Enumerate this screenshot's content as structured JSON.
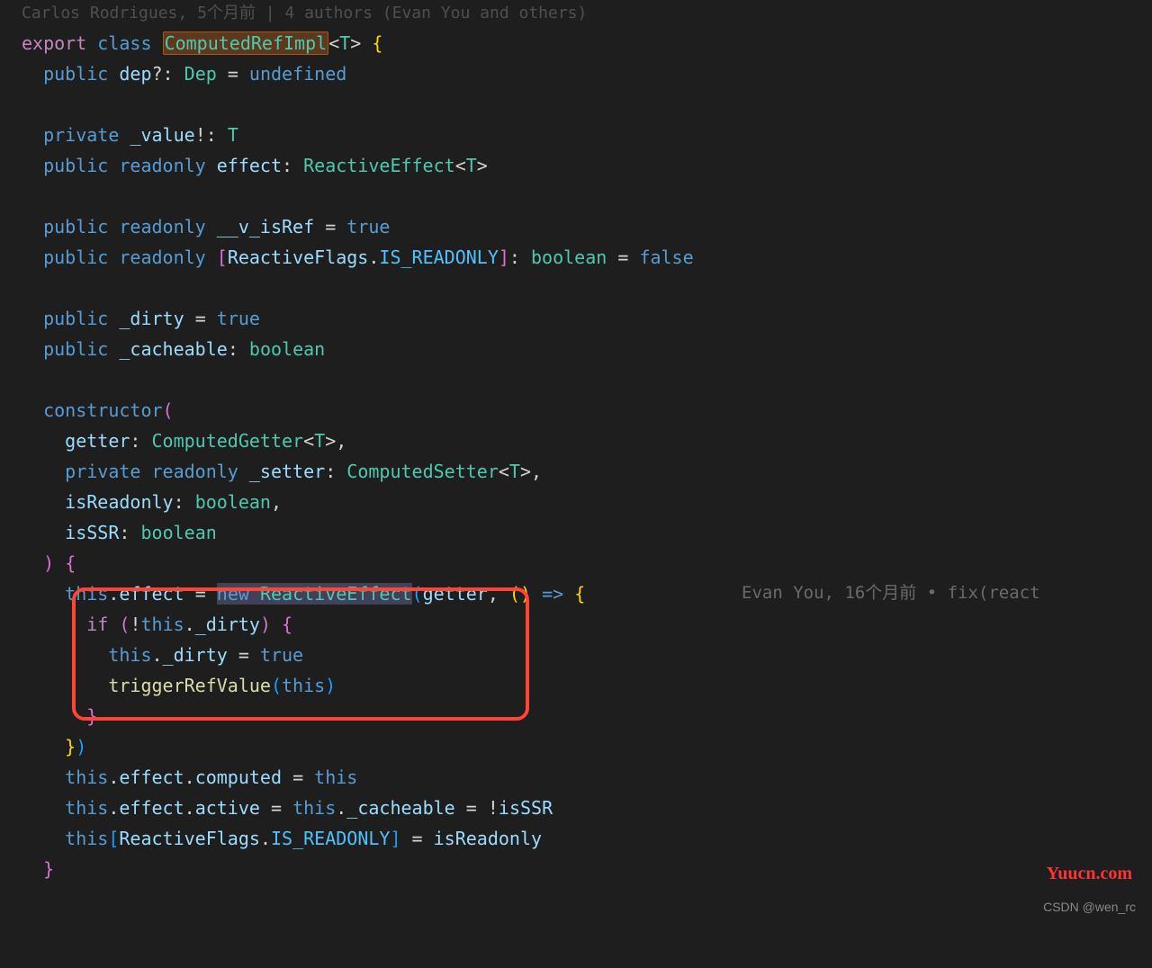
{
  "blame": {
    "top": "Carlos Rodrigues, 5个月前 | 4 authors (Evan You and others)",
    "inline": "Evan You, 16个月前 • fix(react"
  },
  "code": {
    "export": "export",
    "class": "class",
    "className": "ComputedRefImpl",
    "generic": "T",
    "public": "public",
    "private": "private",
    "readonly": "readonly",
    "constructor": "constructor",
    "this": "this",
    "new": "new",
    "if": "if",
    "undefined": "undefined",
    "true": "true",
    "false": "false",
    "boolean": "boolean",
    "dep": "dep",
    "depType": "Dep",
    "_value": "_value",
    "effect": "effect",
    "reactiveEffect": "ReactiveEffect",
    "__v_isRef": "__v_isRef",
    "reactiveFlags": "ReactiveFlags",
    "isReadonlyFlag": "IS_READONLY",
    "_dirty": "_dirty",
    "_cacheable": "_cacheable",
    "getter": "getter",
    "computedGetter": "ComputedGetter",
    "_setter": "_setter",
    "computedSetter": "ComputedSetter",
    "isReadonly": "isReadonly",
    "isSSR": "isSSR",
    "triggerRefValue": "triggerRefValue",
    "computed": "computed",
    "active": "active"
  },
  "watermarks": {
    "csdn": "CSDN @wen_rc",
    "yuucn": "Yuucn.com"
  }
}
